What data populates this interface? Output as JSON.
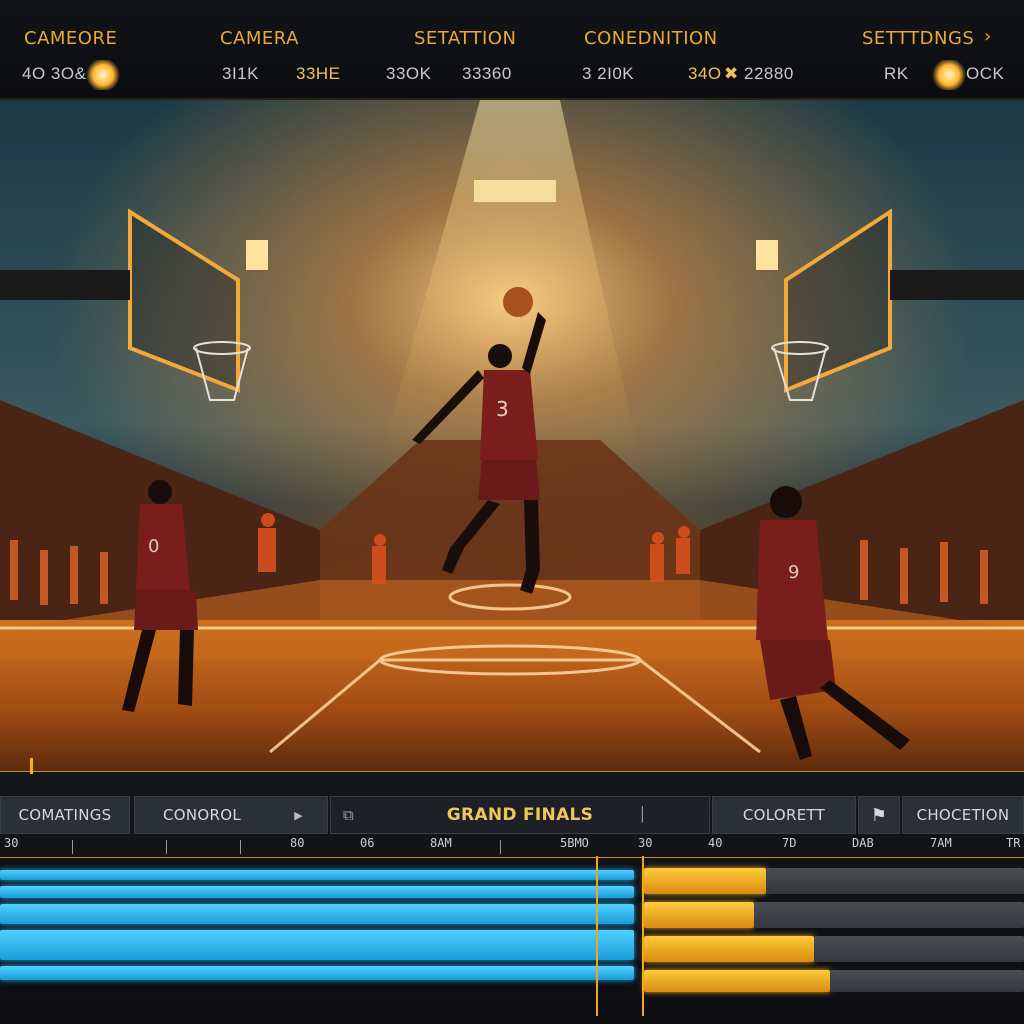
{
  "topbar": {
    "menu": [
      {
        "label": "CAMEORE"
      },
      {
        "label": "CAMERA"
      },
      {
        "label": "SETATTION"
      },
      {
        "label": "CONEDNITION"
      },
      {
        "label": "SETTTDNGS"
      }
    ],
    "readouts": [
      {
        "label": "4O 3O&"
      },
      {
        "label": "3I1K"
      },
      {
        "label": "33HE"
      },
      {
        "label": "33OK"
      },
      {
        "label": "33360"
      },
      {
        "label": "3 2I0K"
      },
      {
        "label": "34O"
      },
      {
        "label": "22880"
      },
      {
        "label": "RK"
      },
      {
        "label": "OCK"
      }
    ],
    "arrow_icon": "chevron-right-icon"
  },
  "player": {
    "jersey_main": "3",
    "jersey_left": "0",
    "jersey_right": "9"
  },
  "timeline": {
    "tabs": {
      "coatings": "COMATINGS",
      "control": "CONOROL",
      "title": "GRAND FINALS",
      "colorett": "COLORETT",
      "choction": "CHOCETION"
    },
    "ruler": [
      "30",
      "80",
      "06",
      "8AM",
      "5BMO",
      "30",
      "40",
      "7D",
      "DAB",
      "7AM",
      "TR"
    ]
  },
  "colors": {
    "accent": "#f2b01e",
    "blue_track": "#1aa7e8",
    "gold_track": "#e8a21a"
  }
}
